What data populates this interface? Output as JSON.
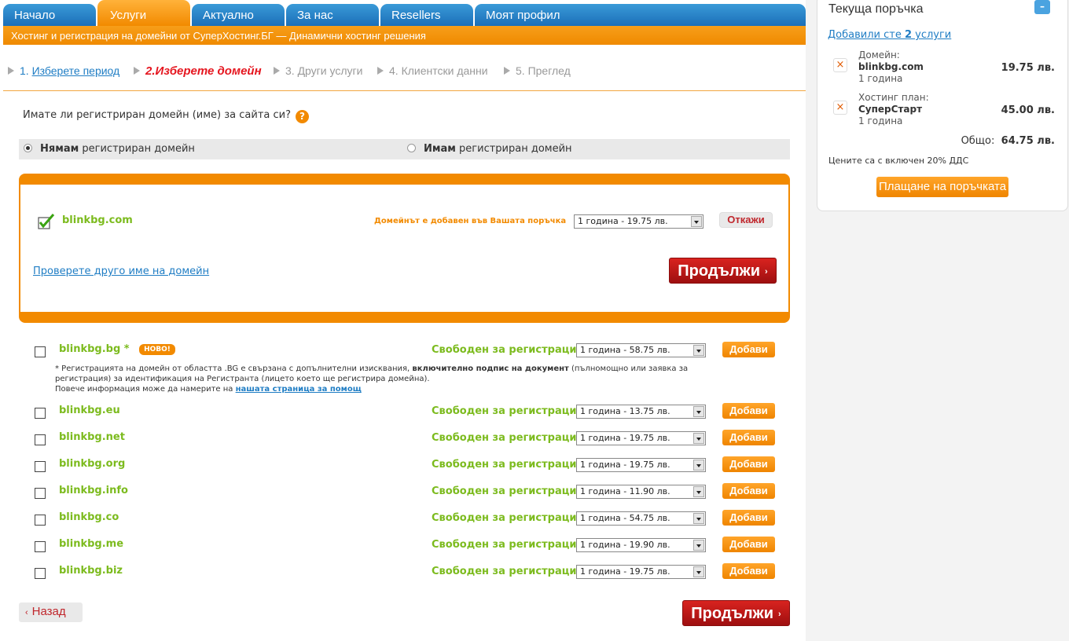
{
  "nav": {
    "tabs": [
      "Начало",
      "Услуги",
      "Актуално",
      "За нас",
      "Resellers",
      "Моят профил"
    ],
    "subtitle": "Хостинг и регистрация на домейни от СуперХостинг.БГ — Динамични хостинг решения"
  },
  "steps": {
    "s1_num": "1.",
    "s1_label": "Изберете период",
    "s2": "2.Изберете домейн",
    "s3": "3. Други услуги",
    "s4": "4. Клиентски данни",
    "s5": "5. Преглед"
  },
  "question": "Имате ли регистриран домейн (име) за сайта си?",
  "help_glyph": "?",
  "radio": {
    "no_bold": "Нямам",
    "no_rest": " регистриран домейн",
    "yes_bold": "Имам",
    "yes_rest": " регистриран домейн"
  },
  "chosen": {
    "domain": "blinkbg.com",
    "status": "Домейнът е добавен във Вашата поръчка",
    "period": "1 година - 19.75 лв.",
    "cancel": "Откажи",
    "check_other": "Проверете друго име на домейн"
  },
  "continue_label": "Продължи",
  "arrow_right": "›",
  "arrow_left": "‹",
  "novo": "НОВО!",
  "domains": [
    {
      "name": "blinkbg.bg *",
      "status": "Свободен за регистрация",
      "period": "1 година - 58.75 лв.",
      "add": "Добави"
    },
    {
      "name": "blinkbg.eu",
      "status": "Свободен за регистрация",
      "period": "1 година - 13.75 лв.",
      "add": "Добави"
    },
    {
      "name": "blinkbg.net",
      "status": "Свободен за регистрация",
      "period": "1 година - 19.75 лв.",
      "add": "Добави"
    },
    {
      "name": "blinkbg.org",
      "status": "Свободен за регистрация",
      "period": "1 година - 19.75 лв.",
      "add": "Добави"
    },
    {
      "name": "blinkbg.info",
      "status": "Свободен за регистрация",
      "period": "1 година - 11.90 лв.",
      "add": "Добави"
    },
    {
      "name": "blinkbg.co",
      "status": "Свободен за регистрация",
      "period": "1 година - 54.75 лв.",
      "add": "Добави"
    },
    {
      "name": "blinkbg.me",
      "status": "Свободен за регистрация",
      "period": "1 година - 19.90 лв.",
      "add": "Добави"
    },
    {
      "name": "blinkbg.biz",
      "status": "Свободен за регистрация",
      "period": "1 година - 19.75 лв.",
      "add": "Добави"
    }
  ],
  "bg_note": {
    "p1": "* Регистрацията на домейн от областта .BG е свързана с допълнителни изисквания, ",
    "p1_bold": "включително подпис на документ",
    "p2": " (пълномощно или заявка за регистрация) за идентификация на Регистранта (лицето което ще регистрира домейна).",
    "p3": "Повече информация може да намерите на ",
    "link": "нашата страница за помощ"
  },
  "back_label": "Назад",
  "order": {
    "title": "Текуща поръчка",
    "collapse": "–",
    "added_pre": "Добавили сте ",
    "added_count": "2",
    "added_post": " услуги",
    "remove_glyph": "×",
    "items": [
      {
        "type": "Домейн:",
        "name": "blinkbg.com",
        "period": "1 година",
        "price": "19.75 лв."
      },
      {
        "type": "Хостинг план:",
        "name": "СуперСтарт",
        "period": "1 година",
        "price": "45.00 лв."
      }
    ],
    "total_label": "Общо:",
    "total_value": "64.75 лв.",
    "vat_note": "Цените са с включен 20% ДДС",
    "pay": "Плащане на поръчката"
  }
}
